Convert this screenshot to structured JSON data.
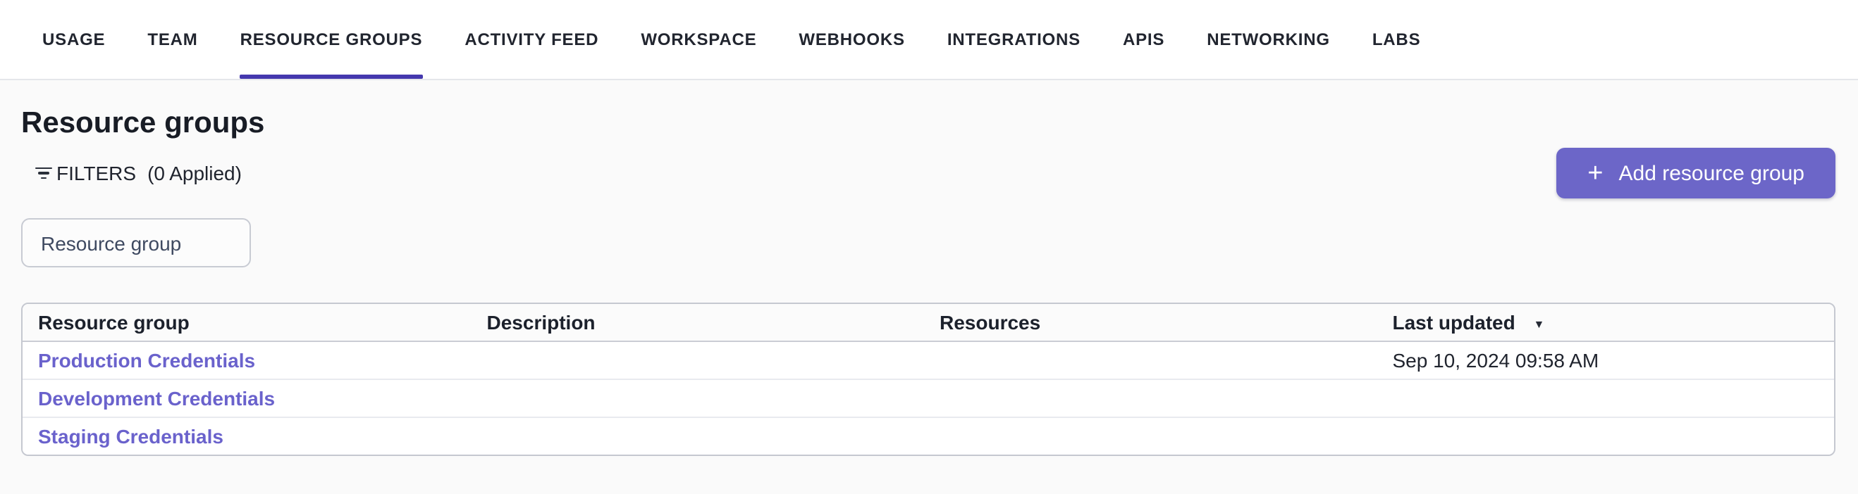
{
  "nav": {
    "tabs": [
      {
        "label": "USAGE"
      },
      {
        "label": "TEAM"
      },
      {
        "label": "RESOURCE GROUPS"
      },
      {
        "label": "ACTIVITY FEED"
      },
      {
        "label": "WORKSPACE"
      },
      {
        "label": "WEBHOOKS"
      },
      {
        "label": "INTEGRATIONS"
      },
      {
        "label": "APIS"
      },
      {
        "label": "NETWORKING"
      },
      {
        "label": "LABS"
      }
    ],
    "active_tab": "RESOURCE GROUPS"
  },
  "page": {
    "title": "Resource groups"
  },
  "filters": {
    "label": "FILTERS",
    "applied_text": "(0 Applied)",
    "icon": "filter-list-icon"
  },
  "actions": {
    "add_button_label": "Add resource group",
    "add_button_plus": "+",
    "add_button_icon": "plus-icon"
  },
  "search": {
    "placeholder": "Resource group"
  },
  "table": {
    "columns": [
      {
        "label": "Resource group"
      },
      {
        "label": "Description"
      },
      {
        "label": "Resources"
      },
      {
        "label": "Last updated",
        "sort": "desc",
        "sort_glyph": "▼",
        "sort_icon": "sort-desc-arrow-icon"
      }
    ],
    "rows": [
      {
        "resource_group": "Production Credentials",
        "description": "",
        "resources": "",
        "last_updated": "Sep 10, 2024 09:58 AM"
      },
      {
        "resource_group": "Development Credentials",
        "description": "",
        "resources": "",
        "last_updated": ""
      },
      {
        "resource_group": "Staging Credentials",
        "description": "",
        "resources": "",
        "last_updated": ""
      }
    ]
  },
  "colors": {
    "accent": "#6c66c8",
    "tab_indicator": "#4438ae",
    "link": "#6a62cc",
    "page_background": "#fafafa",
    "nav_background": "#ffffff",
    "table_border": "#c5c8d0"
  }
}
